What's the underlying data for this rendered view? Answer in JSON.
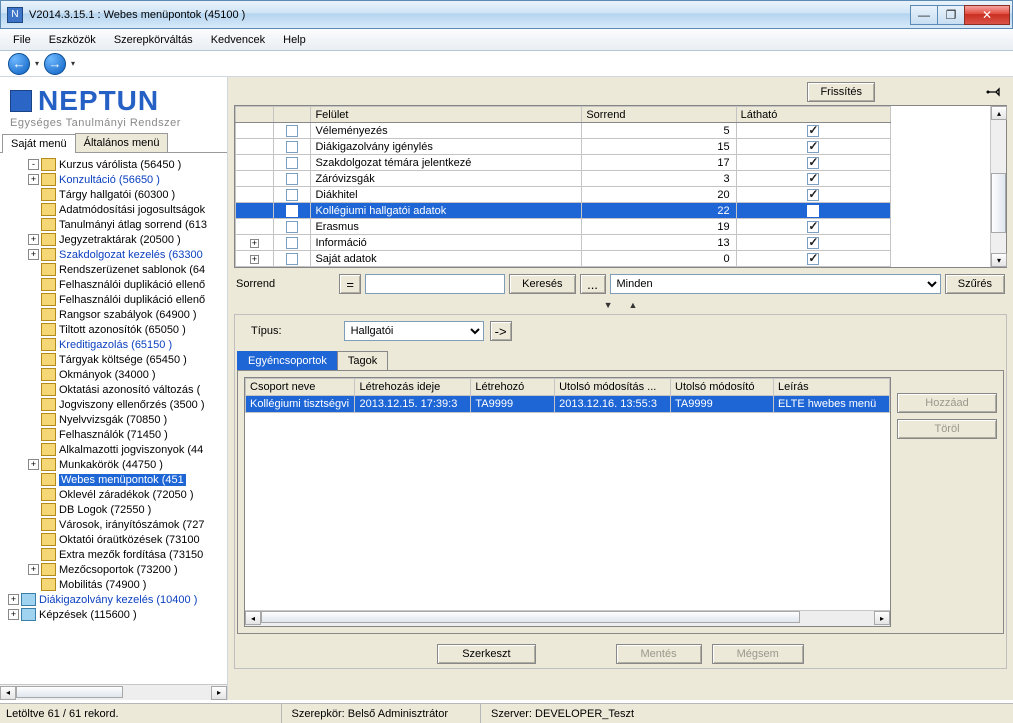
{
  "window": {
    "title": "V2014.3.15.1 : Webes menüpontok (45100  )"
  },
  "menu": {
    "file": "File",
    "tools": "Eszközök",
    "roles": "Szerepkörváltás",
    "fav": "Kedvencek",
    "help": "Help"
  },
  "logo": {
    "brand": "NEPTUN",
    "sub": "Egységes Tanulmányi Rendszer"
  },
  "leftTabs": {
    "own": "Saját menü",
    "general": "Általános menü"
  },
  "tree": [
    {
      "exp": "-",
      "label": "Kurzus várólista (56450  )",
      "indent": 1
    },
    {
      "exp": "+",
      "label": "Konzultáció (56650  )",
      "indent": 1,
      "link": true
    },
    {
      "label": "Tárgy hallgatói (60300  )",
      "indent": 1
    },
    {
      "label": "Adatmódosítási jogosultságok",
      "indent": 1
    },
    {
      "label": "Tanulmányi átlag sorrend (613",
      "indent": 1
    },
    {
      "exp": "+",
      "label": "Jegyzetraktárak (20500  )",
      "indent": 1
    },
    {
      "exp": "+",
      "label": "Szakdolgozat kezelés (63300",
      "indent": 1,
      "link": true
    },
    {
      "label": "Rendszerüzenet sablonok (64",
      "indent": 1
    },
    {
      "label": "Felhasználói duplikáció ellenő",
      "indent": 1
    },
    {
      "label": "Felhasználói duplikáció ellenő",
      "indent": 1
    },
    {
      "label": "Rangsor szabályok (64900  )",
      "indent": 1
    },
    {
      "label": "Tiltott azonosítók (65050  )",
      "indent": 1
    },
    {
      "label": "Kreditigazolás (65150  )",
      "indent": 1,
      "link": true
    },
    {
      "label": "Tárgyak költsége (65450  )",
      "indent": 1
    },
    {
      "label": "Okmányok (34000  )",
      "indent": 1
    },
    {
      "label": "Oktatási azonosító változás (",
      "indent": 1
    },
    {
      "label": "Jogviszony ellenőrzés (3500  )",
      "indent": 1
    },
    {
      "label": "Nyelvvizsgák (70850  )",
      "indent": 1
    },
    {
      "label": "Felhasználók (71450  )",
      "indent": 1
    },
    {
      "label": "Alkalmazotti jogviszonyok (44",
      "indent": 1
    },
    {
      "exp": "+",
      "label": "Munkakörök (44750  )",
      "indent": 1
    },
    {
      "label": "Webes menüpontok (451",
      "indent": 1,
      "sel": true
    },
    {
      "label": "Oklevél záradékok (72050  )",
      "indent": 1
    },
    {
      "label": "DB Logok (72550  )",
      "indent": 1
    },
    {
      "label": "Városok, irányítószámok (727",
      "indent": 1
    },
    {
      "label": "Oktatói óraütközések (73100",
      "indent": 1
    },
    {
      "label": "Extra mezők fordítása (73150",
      "indent": 1
    },
    {
      "exp": "+",
      "label": "Mezőcsoportok (73200  )",
      "indent": 1
    },
    {
      "label": "Mobilitás (74900  )",
      "indent": 1
    },
    {
      "exp": "+",
      "label": "Diákigazolvány kezelés (10400  )",
      "indent": 0,
      "link": true,
      "book": true
    },
    {
      "exp": "+",
      "label": "Képzések (115600  )",
      "indent": 0,
      "book": true
    }
  ],
  "topButtons": {
    "refresh": "Frissítés"
  },
  "grid": {
    "headers": {
      "c3": "Felület",
      "c4": "Sorrend",
      "c5": "Látható"
    },
    "rows": [
      {
        "label": "Véleményezés",
        "order": 5,
        "vis": true
      },
      {
        "label": "Diákigazolvány igénylés",
        "order": 15,
        "vis": true
      },
      {
        "label": "Szakdolgozat témára jelentkezé",
        "order": 17,
        "vis": true
      },
      {
        "label": "Záróvizsgák",
        "order": 3,
        "vis": true
      },
      {
        "label": "Diákhitel",
        "order": 20,
        "vis": true
      },
      {
        "label": "Kollégiumi hallgatói adatok",
        "order": 22,
        "vis": false,
        "sel": true
      },
      {
        "label": "Erasmus",
        "order": 19,
        "vis": true
      },
      {
        "exp": "+",
        "label": "Információ",
        "order": 13,
        "vis": true
      },
      {
        "exp": "+",
        "label": "Saját adatok",
        "order": 0,
        "vis": true
      }
    ]
  },
  "search": {
    "label": "Sorrend",
    "btnSearch": "Keresés",
    "btnDots": "...",
    "selectAll": "Minden",
    "btnFilter": "Szűrés"
  },
  "typeRow": {
    "label": "Típus:",
    "value": "Hallgatói",
    "arrow": "->"
  },
  "subTabs": {
    "groups": "Egyéncsoportok",
    "members": "Tagok"
  },
  "bgrid": {
    "headers": [
      "Csoport neve",
      "Létrehozás ideje",
      "Létrehozó",
      "Utolsó módosítás ...",
      "Utolsó módosító",
      "Leírás"
    ],
    "row": [
      "Kollégiumi tisztségvi",
      "2013.12.15. 17:39:3",
      "TA9999",
      "2013.12.16. 13:55:3",
      "TA9999",
      "ELTE hwebes menü"
    ]
  },
  "sideButtons": {
    "add": "Hozzáad",
    "del": "Töröl"
  },
  "actions": {
    "edit": "Szerkeszt",
    "save": "Mentés",
    "cancel": "Mégsem"
  },
  "status": {
    "records": "Letöltve 61 / 61 rekord.",
    "role": "Szerepkör: Belső Adminisztrátor",
    "server": "Szerver: DEVELOPER_Teszt"
  }
}
